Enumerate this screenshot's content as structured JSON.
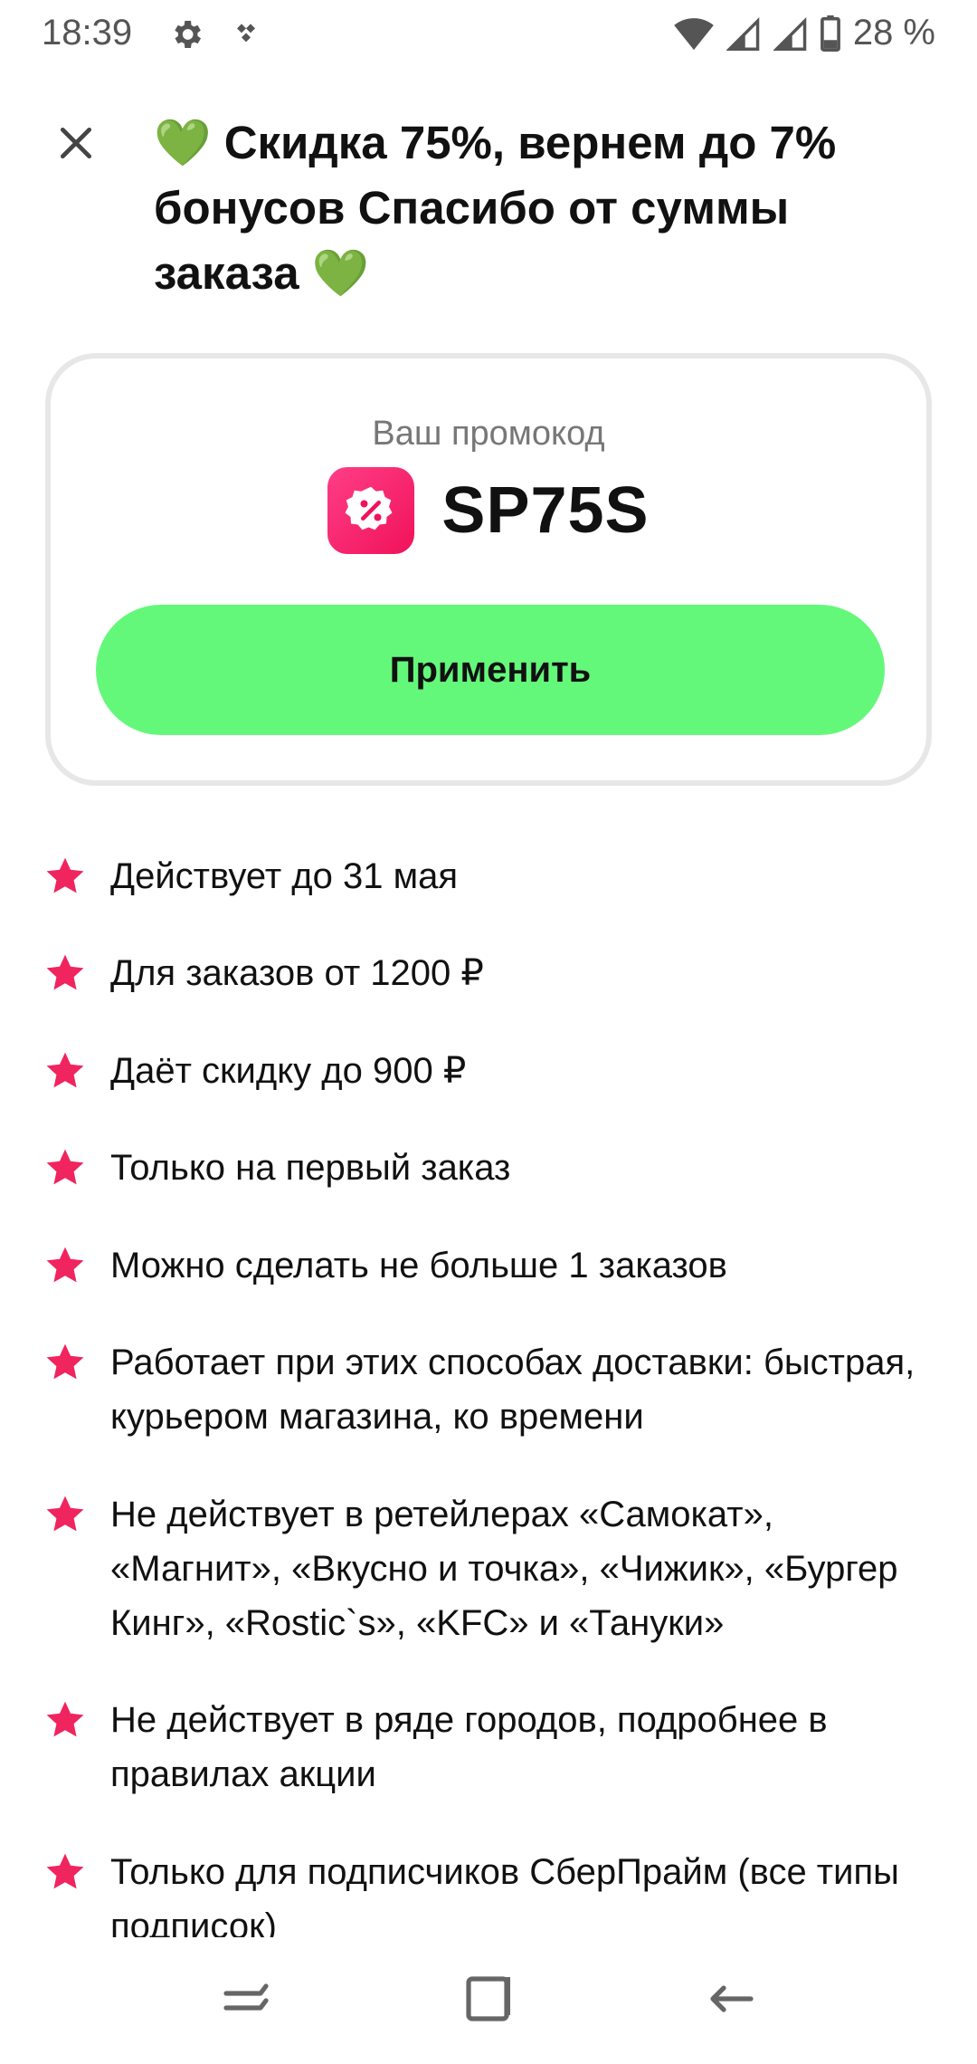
{
  "status_bar": {
    "time": "18:39",
    "battery_text": "28 %",
    "left_icons": [
      "gear-icon",
      "notification-app-icon"
    ],
    "right_icons": [
      "wifi-icon",
      "signal-icon",
      "signal-icon",
      "battery-icon"
    ]
  },
  "header": {
    "close_icon": "close-icon",
    "title_heart_left": "💚",
    "title_text": "Скидка 75%, вернем до 7% бонусов Спасибо от суммы заказа",
    "title_heart_right": "💚",
    "heart_color": "#3cb043"
  },
  "promo": {
    "label": "Ваш промокод",
    "icon": "discount-badge-icon",
    "code": "SP75S",
    "apply_label": "Применить",
    "apply_color": "#64f87a",
    "icon_color": "#f0125a"
  },
  "conditions": {
    "bullet_icon": "star-icon",
    "bullet_color": "#f0245e",
    "items": [
      "Действует до 31 мая",
      "Для заказов от 1200 ₽",
      "Даёт скидку до 900 ₽",
      "Только на первый заказ",
      "Можно сделать не больше 1 заказов",
      "Работает при этих способах доставки: быстрая, курьером магазина, ко времени",
      "Не действует в ретейлерах «Самокат», «Магнит», «Вкусно и точка», «Чижик», «Бургер Кинг», «Rostic`s», «KFC» и «Тануки»",
      "Не действует в ряде городов, подробнее в правилах акции",
      "Только для подписчиков СберПрайм (все типы подписок)"
    ]
  },
  "nav_bar": {
    "buttons": [
      "recent-apps-icon",
      "home-icon",
      "back-icon"
    ]
  }
}
